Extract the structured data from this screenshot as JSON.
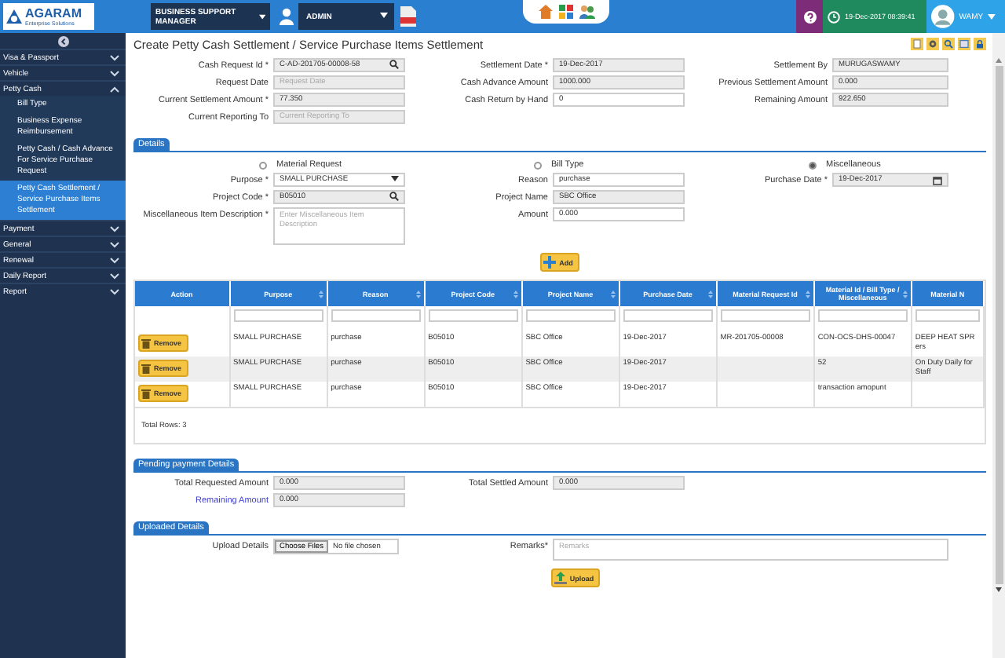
{
  "header": {
    "logo": {
      "name": "AGARAM",
      "tagline": "Enterprise Solutions"
    },
    "role": "BUSINESS SUPPORT MANAGER",
    "user_menu": "ADMIN",
    "datetime": "19-Dec-2017 08:39:41",
    "user": "WAMY"
  },
  "sidebar": {
    "items": [
      {
        "label": "Visa & Passport",
        "expanded": false
      },
      {
        "label": "Vehicle",
        "expanded": false
      },
      {
        "label": "Petty Cash",
        "expanded": true,
        "children": [
          {
            "label": "Bill Type",
            "selected": false
          },
          {
            "label": "Business Expense Reimbursement",
            "selected": false
          },
          {
            "label": "Petty Cash / Cash Advance For Service Purchase Request",
            "selected": false
          },
          {
            "label": "Petty Cash Settlement / Service Purchase Items Settlement",
            "selected": true
          }
        ]
      },
      {
        "label": "Payment",
        "expanded": false
      },
      {
        "label": "General",
        "expanded": false
      },
      {
        "label": "Renewal",
        "expanded": false
      },
      {
        "label": "Daily Report",
        "expanded": false
      },
      {
        "label": "Report",
        "expanded": false
      }
    ]
  },
  "page": {
    "title": "Create Petty Cash Settlement / Service Purchase Items Settlement"
  },
  "top_form": {
    "rows": [
      [
        {
          "label": "Cash Request Id *",
          "kind": "search",
          "value": "C-AD-201705-00008-58"
        },
        {
          "label": "Settlement Date *",
          "kind": "readonly",
          "value": "19-Dec-2017"
        },
        {
          "label": "Settlement By",
          "kind": "readonly",
          "value": "MURUGASWAMY"
        }
      ],
      [
        {
          "label": "Request Date",
          "kind": "readonly",
          "placeholder": "Request Date"
        },
        {
          "label": "Cash Advance Amount",
          "kind": "readonly",
          "value": "1000.000"
        },
        {
          "label": "Previous Settlement Amount",
          "kind": "readonly",
          "value": "0.000"
        }
      ],
      [
        {
          "label": "Current Settlement Amount *",
          "kind": "readonly",
          "value": "77.350"
        },
        {
          "label": "Cash Return by Hand",
          "kind": "input",
          "value": "0"
        },
        {
          "label": "Remaining Amount",
          "kind": "readonly",
          "value": "922.650"
        }
      ],
      [
        {
          "label": "Current Reporting To",
          "kind": "readonly",
          "placeholder": "Current Reporting To"
        }
      ]
    ]
  },
  "details": {
    "title": "Details",
    "radios": [
      {
        "label": "Material Request",
        "selected": false
      },
      {
        "label": "Bill Type",
        "selected": false
      },
      {
        "label": "Miscellaneous",
        "selected": true
      }
    ],
    "rows": [
      [
        {
          "label": "Purpose *",
          "kind": "select",
          "value": "SMALL PURCHASE"
        },
        {
          "label": "Reason",
          "kind": "input",
          "value": "purchase"
        },
        {
          "label": "Purchase Date *",
          "kind": "date",
          "value": "19-Dec-2017"
        }
      ],
      [
        {
          "label": "Project Code *",
          "kind": "search",
          "value": "B05010"
        },
        {
          "label": "Project Name",
          "kind": "readonly",
          "value": "SBC Office"
        }
      ],
      [
        {
          "label": "Miscellaneous Item Description *",
          "kind": "textarea",
          "placeholder": "Enter Miscellaneous Item Description"
        },
        {
          "label": "Amount",
          "kind": "input",
          "value": "0.000"
        }
      ]
    ],
    "add_button": "Add"
  },
  "table": {
    "columns": [
      {
        "label": "Action",
        "sortable": false
      },
      {
        "label": "Purpose",
        "sortable": true
      },
      {
        "label": "Reason",
        "sortable": true
      },
      {
        "label": "Project Code",
        "sortable": true
      },
      {
        "label": "Project Name",
        "sortable": true
      },
      {
        "label": "Purchase Date",
        "sortable": true
      },
      {
        "label": "Material Request Id",
        "sortable": true
      },
      {
        "label": "Material Id / Bill Type / Miscellaneous",
        "sortable": true
      },
      {
        "label": "Material N",
        "sortable": false
      }
    ],
    "rows": [
      {
        "cells": [
          "Remove",
          "SMALL PURCHASE",
          "purchase",
          "B05010",
          "SBC Office",
          "19-Dec-2017",
          "MR-201705-00008",
          "CON-OCS-DHS-00047",
          "DEEP HEAT SPR ers"
        ]
      },
      {
        "cells": [
          "Remove",
          "SMALL PURCHASE",
          "purchase",
          "B05010",
          "SBC Office",
          "19-Dec-2017",
          "",
          "52",
          "On Duty Daily for Staff"
        ]
      },
      {
        "cells": [
          "Remove",
          "SMALL PURCHASE",
          "purchase",
          "B05010",
          "SBC Office",
          "19-Dec-2017",
          "",
          "transaction amopunt",
          ""
        ]
      }
    ],
    "total": "Total Rows: 3"
  },
  "pending": {
    "title": "Pending payment Details",
    "rows": [
      [
        {
          "label": "Total Requested Amount",
          "kind": "readonly",
          "value": "0.000",
          "highlight": false
        },
        {
          "label": "Total Settled Amount",
          "kind": "readonly",
          "value": "0.000",
          "highlight": false
        }
      ],
      [
        {
          "label": "Remaining Amount",
          "kind": "readonly",
          "value": "0.000",
          "highlight": true
        }
      ]
    ]
  },
  "uploaded": {
    "title": "Uploaded Details",
    "rows": [
      [
        {
          "label": "Upload Details",
          "kind": "file",
          "button": "Choose Files",
          "value": "No file chosen"
        },
        {
          "label": "Remarks*",
          "kind": "remarks",
          "placeholder": "Remarks"
        }
      ]
    ],
    "upload_button": "Upload"
  }
}
